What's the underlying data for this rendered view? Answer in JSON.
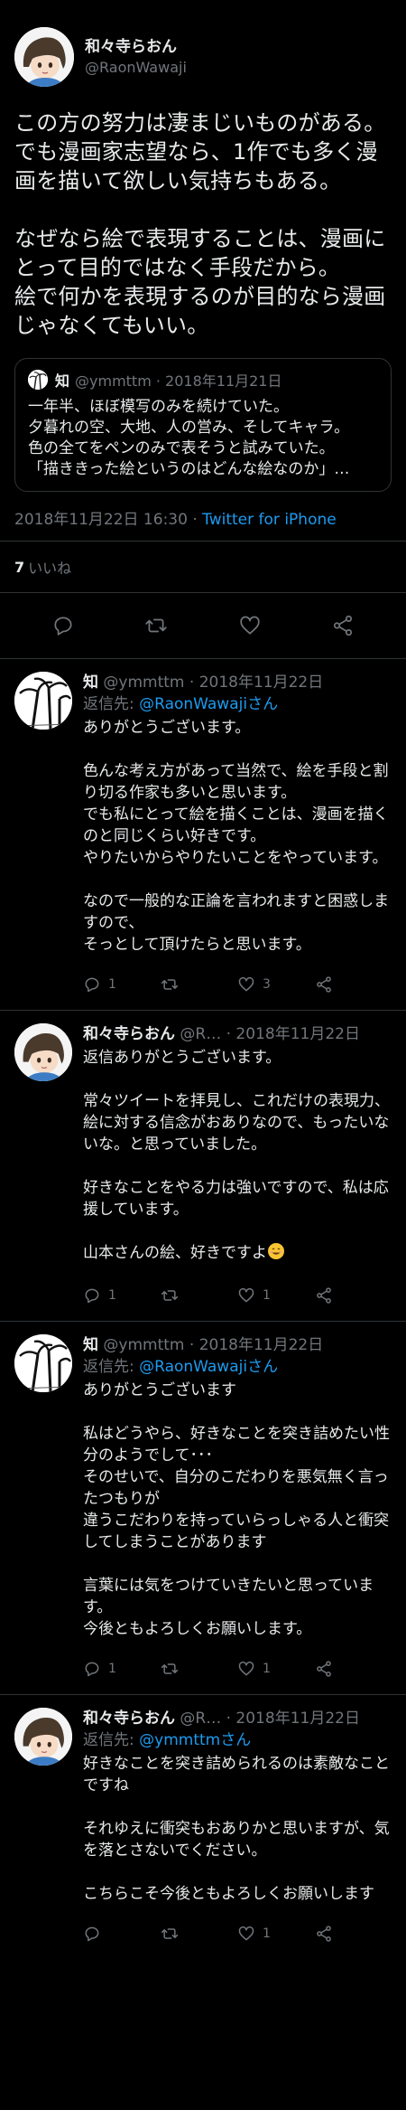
{
  "main_tweet": {
    "display_name": "和々寺らおん",
    "handle": "@RaonWawaji",
    "text": "この方の努力は凄まじいものがある。\nでも漫画家志望なら、1作でも多く漫画を描いて欲しい気持ちもある。\n\nなぜなら絵で表現することは、漫画にとって目的ではなく手段だから。\n絵で何かを表現するのが目的なら漫画じゃなくてもいい。",
    "quote": {
      "name": "知",
      "meta": "@ymmttm · 2018年11月21日",
      "text": "一年半、ほぼ模写のみを続けていた。\n夕暮れの空、大地、人の営み、そしてキャラ。\n色の全てをペンのみで表そうと試みていた。\n「描ききった絵というのはどんな絵なのか」…"
    },
    "timestamp": "2018年11月22日 16:30",
    "separator": " · ",
    "via": "Twitter for iPhone",
    "likes_count": "7",
    "likes_label": "いいね"
  },
  "icons": {
    "reply": "reply-icon",
    "retweet": "retweet-icon",
    "like": "heart-icon",
    "share": "share-icon"
  },
  "colors": {
    "background": "#000000",
    "text": "#e7e9ea",
    "secondary": "#71767b",
    "link": "#1d9bf0",
    "divider": "#2f3336"
  },
  "replies": [
    {
      "name": "知",
      "meta": "@ymmttm · 2018年11月22日",
      "reply_to_prefix": "返信先: ",
      "reply_to": "@RaonWawajiさん",
      "text": "ありがとうございます。\n\n色んな考え方があって当然で、絵を手段と割り切る作家も多いと思います。\nでも私にとって絵を描くことは、漫画を描くのと同じくらい好きです。\nやりたいからやりたいことをやっています。\n\nなので一般的な正論を言われますと困惑しますので、\nそっとして頂けたらと思います。",
      "emoji": "",
      "replies": "1",
      "retweets": "",
      "likes": "3"
    },
    {
      "name": "和々寺らおん",
      "meta": "@R… · 2018年11月22日",
      "reply_to_prefix": "",
      "reply_to": "",
      "text": "返信ありがとうございます。\n\n常々ツイートを拝見し、これだけの表現力、絵に対する信念がおありなので、もったいないな。と思っていました。\n\n好きなことをやる力は強いですので、私は応援しています。\n\n山本さんの絵、好きですよ",
      "emoji": "smile",
      "replies": "1",
      "retweets": "",
      "likes": "1"
    },
    {
      "name": "知",
      "meta": "@ymmttm · 2018年11月22日",
      "reply_to_prefix": "返信先: ",
      "reply_to": "@RaonWawajiさん",
      "text": "ありがとうございます\n\n私はどうやら、好きなことを突き詰めたい性分のようでして･･･\nそのせいで、自分のこだわりを悪気無く言ったつもりが\n違うこだわりを持っていらっしゃる人と衝突してしまうことがあります\n\n言葉には気をつけていきたいと思っています。\n今後ともよろしくお願いします。",
      "emoji": "",
      "replies": "1",
      "retweets": "",
      "likes": "1"
    },
    {
      "name": "和々寺らおん",
      "meta": "@R… · 2018年11月22日",
      "reply_to_prefix": "返信先: ",
      "reply_to": "@ymmttmさん",
      "text": "好きなことを突き詰められるのは素敵なことですね\n\nそれゆえに衝突もおありかと思いますが、気を落とさないでください。\n\nこちらこそ今後ともよろしくお願いします",
      "emoji": "",
      "replies": "",
      "retweets": "",
      "likes": "1"
    }
  ]
}
